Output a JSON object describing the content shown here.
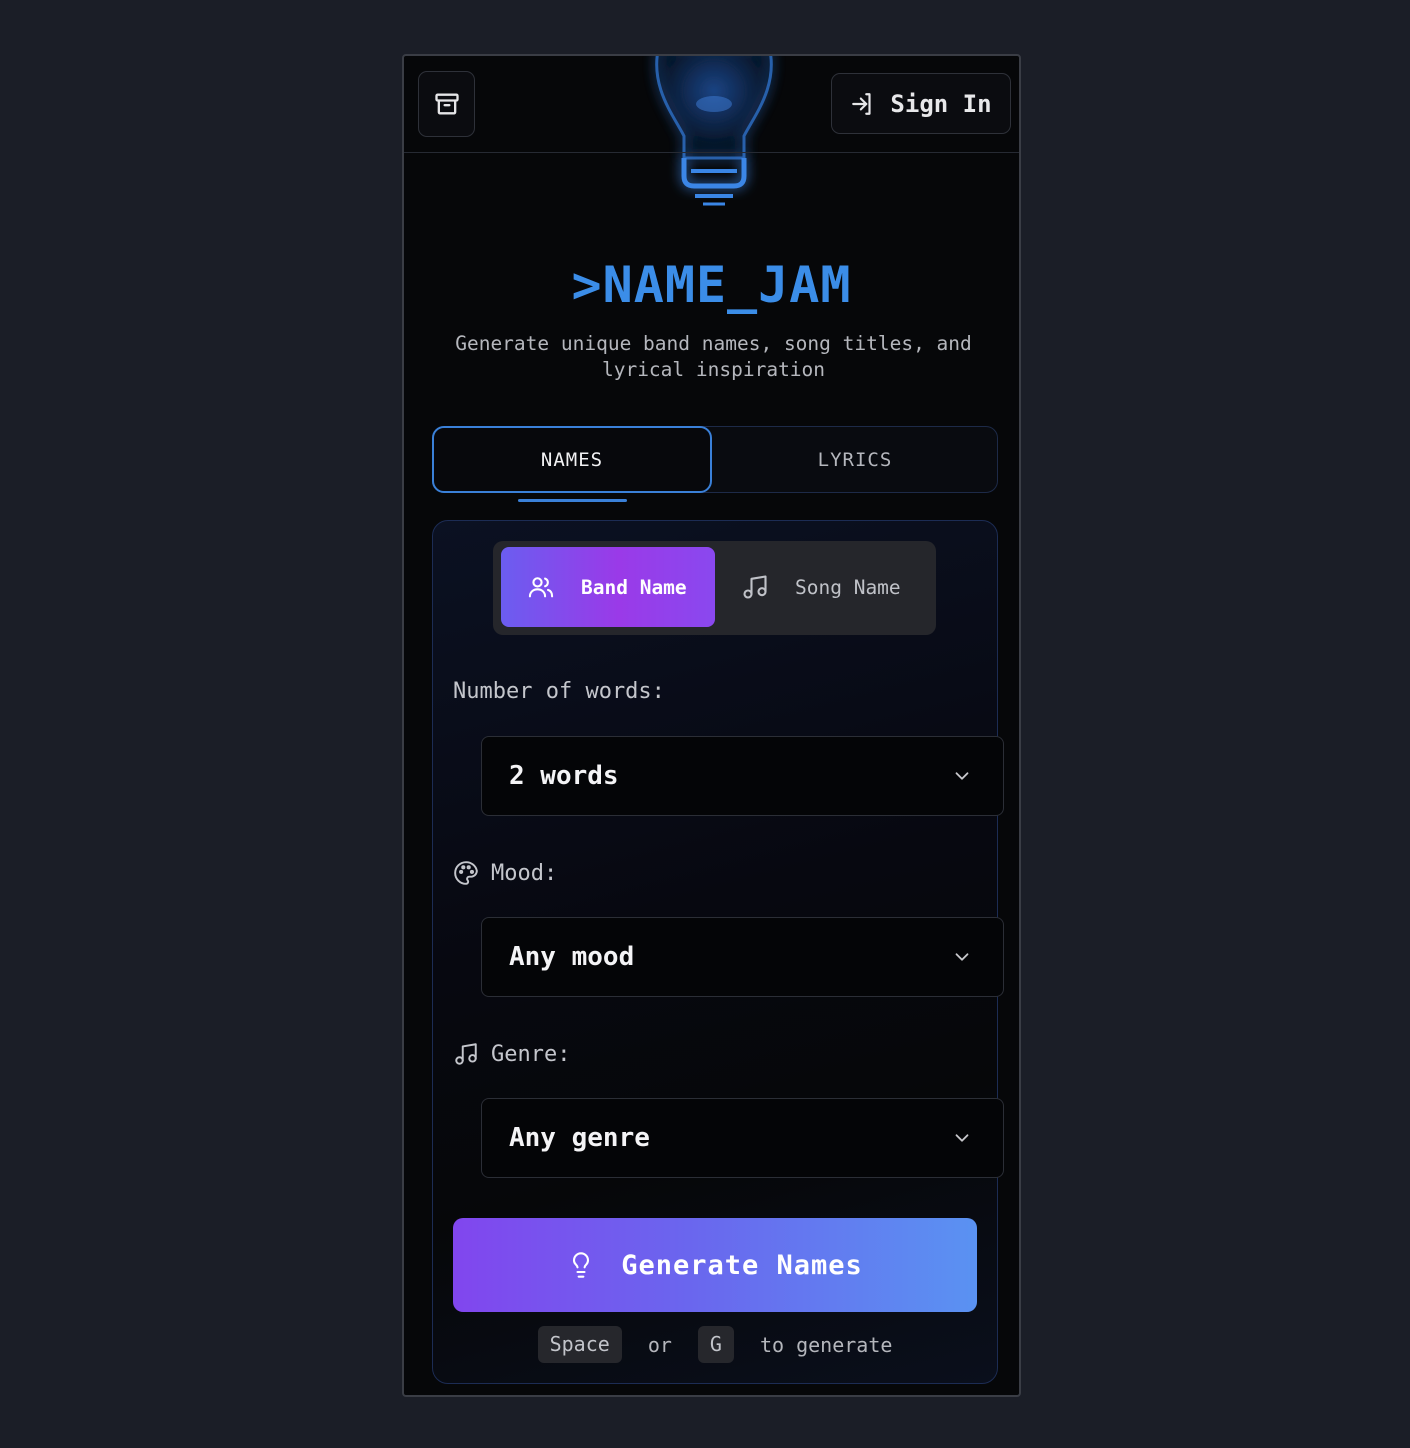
{
  "header": {
    "sign_in_label": "Sign In"
  },
  "brand": {
    "title": ">NAME_JAM",
    "subtitle": "Generate unique band names, song titles, and lyrical inspiration"
  },
  "tabs": [
    {
      "label": "NAMES",
      "active": true
    },
    {
      "label": "LYRICS",
      "active": false
    }
  ],
  "name_type": {
    "options": [
      {
        "label": "Band Name",
        "selected": true,
        "icon": "users-icon"
      },
      {
        "label": "Song Name",
        "selected": false,
        "icon": "music-note-icon"
      }
    ]
  },
  "fields": {
    "words": {
      "label": "Number of words:",
      "value": "2 words"
    },
    "mood": {
      "label": "Mood:",
      "value": "Any mood",
      "icon": "palette-icon"
    },
    "genre": {
      "label": "Genre:",
      "value": "Any genre",
      "icon": "music-note-icon"
    }
  },
  "generate": {
    "label": "Generate Names",
    "hint_key1": "Space",
    "hint_or": "or",
    "hint_key2": "G",
    "hint_suffix": "to generate"
  },
  "colors": {
    "accent_blue": "#3b8de8",
    "gradient_start": "#8146ee",
    "gradient_end": "#5a92f2"
  }
}
